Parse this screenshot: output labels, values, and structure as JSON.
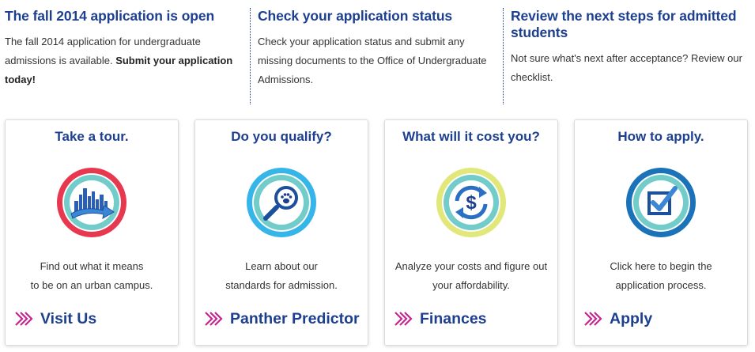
{
  "announcements": [
    {
      "title": "The fall 2014 application is open",
      "body": "The fall 2014 application for undergraduate admissions is available. ",
      "body_bold": "Submit your application today!"
    },
    {
      "title": "Check your application status",
      "body": "Check your application status and submit any missing documents to the Office of Undergraduate Admissions."
    },
    {
      "title": "Review the next steps for admitted students",
      "body": "Not sure what's next after acceptance? Review our checklist."
    }
  ],
  "cards": [
    {
      "title": "Take a tour.",
      "icon": "city-tour-icon",
      "desc_line1": "Find out what it means",
      "desc_line2": "to be on an urban campus.",
      "link": "Visit Us",
      "ring_color": "#e8384f"
    },
    {
      "title": "Do you qualify?",
      "icon": "magnifier-paw-icon",
      "desc_line1": "Learn about our",
      "desc_line2": "standards for admission.",
      "link": "Panther Predictor",
      "ring_color": "#36b5e8"
    },
    {
      "title": "What will it cost you?",
      "icon": "dollar-cycle-icon",
      "desc_line1": "Analyze your costs and figure out",
      "desc_line2": "your affordability.",
      "link": "Finances",
      "ring_color": "#e2e77a"
    },
    {
      "title": "How to apply.",
      "icon": "checkbox-icon",
      "desc_line1": "Click here to begin the",
      "desc_line2": "application process.",
      "link": "Apply",
      "ring_color": "#1a72b9"
    }
  ],
  "colors": {
    "heading": "#1d3f8f",
    "link_arrow": "#c2278d",
    "inner_ring": "#72ccc9"
  }
}
